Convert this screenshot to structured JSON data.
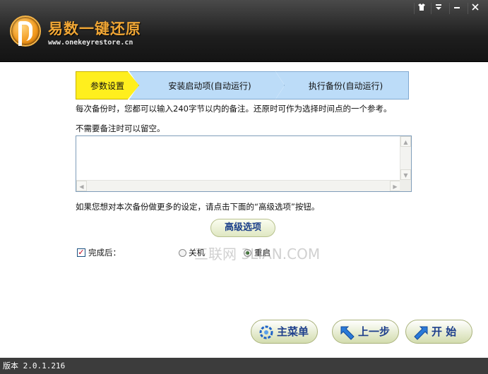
{
  "app": {
    "title": "易数一键还原",
    "url": "www.onekeyrestore.cn",
    "window_controls": [
      "skin-icon",
      "menu-icon",
      "minimize-icon",
      "close-icon"
    ]
  },
  "steps": [
    {
      "label": "参数设置",
      "active": true
    },
    {
      "label": "安装启动项(自动运行)",
      "active": false
    },
    {
      "label": "执行备份(自动运行)",
      "active": false
    }
  ],
  "content": {
    "hint1": "每次备份时，您都可以输入240字节以内的备注。还原时可作为选择时间点的一个参考。",
    "hint2": "不需要备注时可以留空。",
    "note_value": "",
    "hint3": "如果您想对本次备份做更多的设定，请点击下面的“高级选项”按钮。",
    "advanced_label": "高级选项",
    "on_complete_label": "完成后：",
    "on_complete_checked": true,
    "options": [
      {
        "label": "关机",
        "selected": false
      },
      {
        "label": "重启",
        "selected": true
      }
    ],
    "watermark": "三联网 3LIAN.COM"
  },
  "buttons": {
    "main_menu": "主菜单",
    "prev": "上一步",
    "start": "开 始"
  },
  "footer": {
    "version": "版本 2.0.1.216"
  },
  "colors": {
    "active_step": "#ffef1e",
    "inactive_step": "#bcdcf8",
    "header_bg": "#1e1e1e",
    "title_orange": "#f0a635",
    "button_text": "#1e3f8c"
  }
}
